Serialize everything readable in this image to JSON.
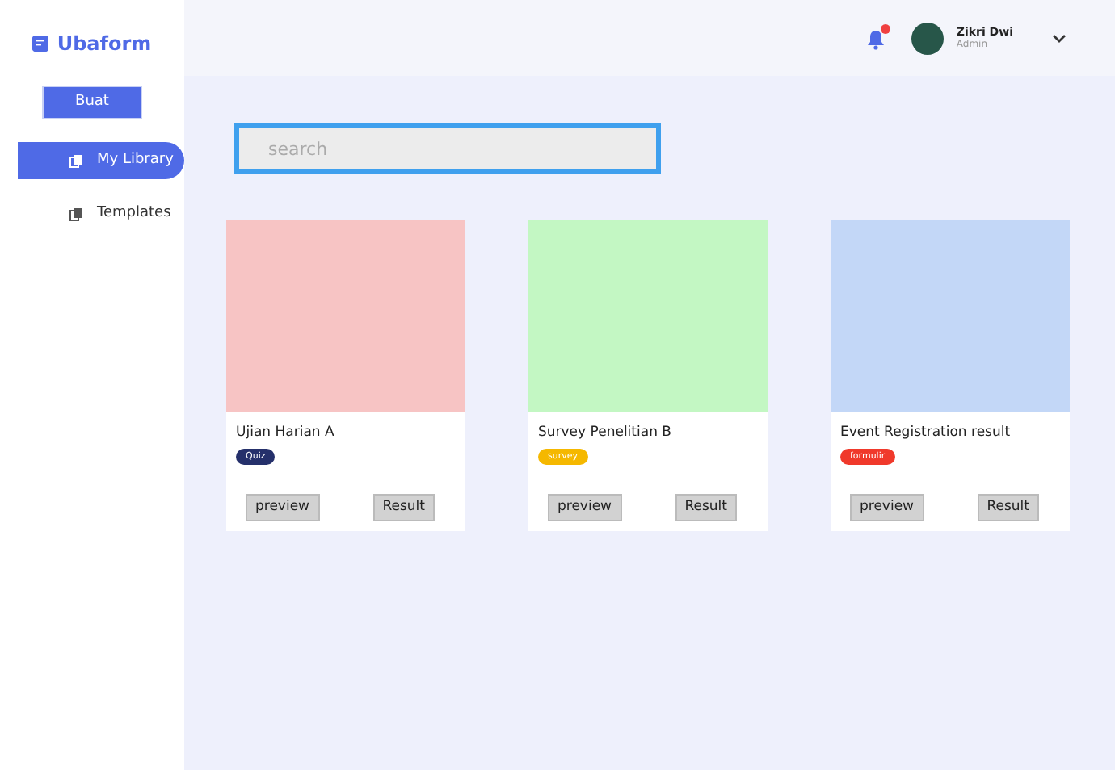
{
  "brand": "Ubaform",
  "create_button": "Buat",
  "sidebar": {
    "items": [
      {
        "label": "My Library",
        "selected": true
      },
      {
        "label": "Templates",
        "selected": false
      }
    ]
  },
  "header": {
    "notification": true,
    "user_name": "Zikri Dwi",
    "user_role": "Admin"
  },
  "search": {
    "placeholder": "search"
  },
  "cards": [
    {
      "color": "#f7c4c4",
      "title": "Ujian Harian A",
      "tag": {
        "label": "Quiz",
        "color": "#25306b"
      },
      "buttons": [
        "preview",
        "Result"
      ]
    },
    {
      "color": "#c3f7c3",
      "title": "Survey Penelitian B",
      "tag": {
        "label": "survey",
        "color": "#f5b800"
      },
      "buttons": [
        "preview",
        "Result"
      ]
    },
    {
      "color": "#c3d7f7",
      "title": "Event Registration result",
      "tag": {
        "label": "formulir",
        "color": "#f0392b"
      },
      "buttons": [
        "preview",
        "Result"
      ]
    }
  ]
}
